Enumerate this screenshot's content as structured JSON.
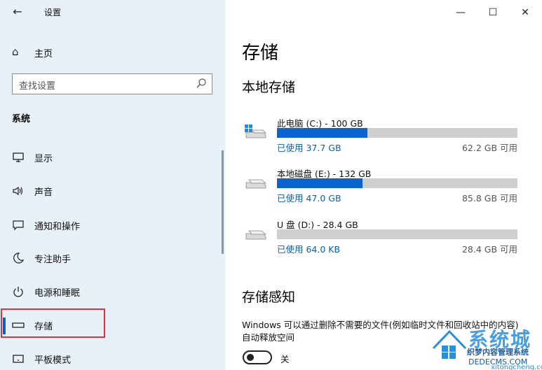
{
  "window": {
    "title": "设置"
  },
  "nav": {
    "home_label": "主页",
    "search_placeholder": "查找设置",
    "section_label": "系统",
    "items": [
      {
        "label": "显示",
        "icon": "monitor-icon"
      },
      {
        "label": "声音",
        "icon": "speaker-icon"
      },
      {
        "label": "通知和操作",
        "icon": "notification-icon"
      },
      {
        "label": "专注助手",
        "icon": "moon-icon"
      },
      {
        "label": "电源和睡眠",
        "icon": "power-icon"
      },
      {
        "label": "存储",
        "icon": "storage-icon",
        "active": true
      },
      {
        "label": "平板模式",
        "icon": "tablet-icon"
      }
    ]
  },
  "main": {
    "title": "存储",
    "local_storage_heading": "本地存储",
    "drives": [
      {
        "name": "此电脑 (C:) - 100 GB",
        "used": "已使用 37.7 GB",
        "free": "62.2 GB 可用",
        "used_fraction": 0.377,
        "icon": "windows-drive-icon"
      },
      {
        "name": "本地磁盘 (E:) - 132 GB",
        "used": "已使用 47.0 GB",
        "free": "85.8 GB 可用",
        "used_fraction": 0.356,
        "icon": "drive-icon"
      },
      {
        "name": "U 盘 (D:) - 28.4 GB",
        "used": "已使用 64.0 KB",
        "free": "28.4 GB 可用",
        "used_fraction": 0.0,
        "icon": "drive-icon"
      }
    ],
    "storage_sense_heading": "存储感知",
    "storage_sense_desc": "Windows 可以通过删除不需要的文件(例如临时文件和回收站中的内容)自动释放空间",
    "toggle_label": "关",
    "toggle_on": false
  },
  "watermark": {
    "line1": "系统城",
    "line2": "织梦内容管理系统",
    "line3": "DEDECMS.COM",
    "line4": "xitongcheng.com"
  },
  "colors": {
    "accent": "#0a64cf",
    "highlight_box": "#e0323a",
    "sidebar_bg": "#e8f0f8"
  }
}
